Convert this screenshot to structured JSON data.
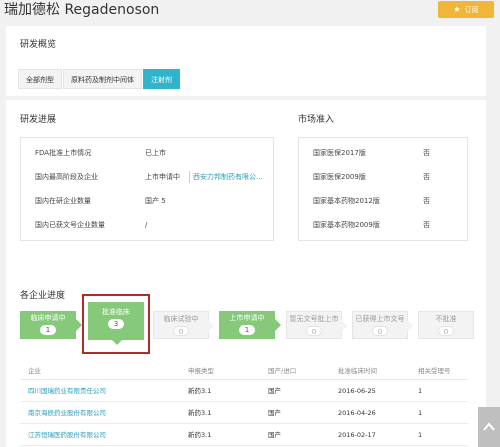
{
  "header": {
    "title": "瑞加德松 Regadenoson",
    "subscribe_label": "订阅",
    "subscribe_color": "#f1b53a"
  },
  "overview": {
    "heading": "研发概览",
    "tabs": [
      {
        "label": "全部剂型",
        "active": false
      },
      {
        "label": "原料药及制剂中间体",
        "active": false
      },
      {
        "label": "注射剂",
        "active": true
      }
    ]
  },
  "rd_progress": {
    "heading": "研发进展",
    "rows": [
      {
        "key": "FDA批准上市情况",
        "value": "已上市"
      },
      {
        "key": "国内最高阶段及企业",
        "value": "上市申请中",
        "company": "西安力邦制药有限公..."
      },
      {
        "key": "国内在研企业数量",
        "value": "国产 5"
      },
      {
        "key": "国内已获文号企业数量",
        "value": "/"
      }
    ]
  },
  "market_access": {
    "heading": "市场准入",
    "rows": [
      {
        "key": "国家医保2017版",
        "value": "否"
      },
      {
        "key": "国家医保2009版",
        "value": "否"
      },
      {
        "key": "国家基本药物2012版",
        "value": "否"
      },
      {
        "key": "国家基本药物2009版",
        "value": "否"
      }
    ]
  },
  "enterprise_progress": {
    "heading": "各企业进度",
    "stages": [
      {
        "label": "临床申请中",
        "count": "1",
        "state": "green"
      },
      {
        "label": "批准临床",
        "count": "3",
        "state": "green-active"
      },
      {
        "label": "临床试验中",
        "count": "0",
        "state": "grey"
      },
      {
        "label": "上市申请中",
        "count": "1",
        "state": "green"
      },
      {
        "label": "暂无文号批上市",
        "count": "0",
        "state": "grey"
      },
      {
        "label": "已获得上市文号",
        "count": "0",
        "state": "grey"
      },
      {
        "label": "不批准",
        "count": "0",
        "state": "grey"
      }
    ]
  },
  "table": {
    "columns": [
      "企业",
      "申报类型",
      "国产/进口",
      "批准临床时间",
      "相关受理号"
    ],
    "rows": [
      [
        "四川国瑞药业有限责任公司",
        "新药3.1",
        "国产",
        "2016-06-25",
        "1"
      ],
      [
        "南京海辰药业股份有限公司",
        "新药3.1",
        "国产",
        "2016-04-26",
        "1"
      ],
      [
        "江苏恒瑞医药股份有限公司",
        "新药3.1",
        "国产",
        "2016-02-17",
        "1"
      ]
    ]
  },
  "colors": {
    "accent": "#2fb4c9",
    "link": "#2a9cb7",
    "stage_green": "#86c97a",
    "highlight": "#b02a2a"
  }
}
